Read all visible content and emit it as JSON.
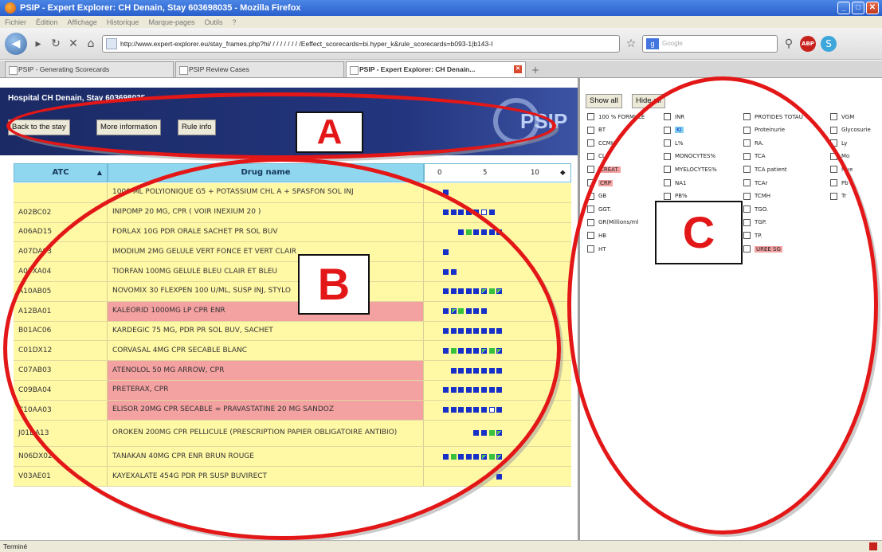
{
  "window": {
    "title": "PSIP - Expert Explorer: CH Denain, Stay 603698035 - Mozilla Firefox"
  },
  "menu": [
    "Fichier",
    "Édition",
    "Affichage",
    "Historique",
    "Marque-pages",
    "Outils",
    "?"
  ],
  "navbar": {
    "url": "http://www.expert-explorer.eu/stay_frames.php?hi/ / / / / / / / /Eeffect_scorecards=bi.hyper_k&rule_scorecards=b093-1|b143-I",
    "search_placeholder": "Google"
  },
  "tabs": [
    {
      "label": "PSIP - Generating Scorecards"
    },
    {
      "label": "PSIP Review Cases"
    },
    {
      "label": "PSIP - Expert Explorer: CH Denain..."
    }
  ],
  "header": {
    "hospital": "Hospital CH Denain, Stay 603698035",
    "buttons": [
      "Back to the stay",
      "More information",
      "Rule info"
    ],
    "logo": "PSIP"
  },
  "grid": {
    "headers": {
      "atc": "ATC",
      "drug": "Drug name",
      "scale": [
        "0",
        "5",
        "10"
      ]
    },
    "rows": [
      {
        "atc": "",
        "drug": "1000 ML POLYIONIQUE G5 + POTASSIUM CHL A + SPASFON SOL INJ",
        "red": false,
        "marks": [
          "b"
        ],
        "offset": 0
      },
      {
        "atc": "A02BC02",
        "drug": "INIPOMP 20 MG, CPR ( VOIR INEXIUM 20 )",
        "red": false,
        "marks": [
          "b",
          "b",
          "b",
          "b",
          "b",
          "h",
          "b"
        ],
        "offset": 0
      },
      {
        "atc": "A06AD15",
        "drug": "FORLAX 10G PDR ORALE SACHET PR SOL BUV",
        "red": false,
        "marks": [
          "b",
          "g",
          "b",
          "b",
          "b",
          "b"
        ],
        "offset": 2
      },
      {
        "atc": "A07DA03",
        "drug": "IMODIUM 2MG GELULE VERT FONCE ET VERT CLAIR",
        "red": false,
        "marks": [
          "b"
        ],
        "offset": 0
      },
      {
        "atc": "A07XA04",
        "drug": "TIORFAN 100MG GELULE BLEU CLAIR ET BLEU",
        "red": false,
        "marks": [
          "b",
          "b"
        ],
        "offset": 0
      },
      {
        "atc": "A10AB05",
        "drug": "NOVOMIX 30 FLEXPEN 100 U/ML, SUSP INJ, STYLO",
        "red": false,
        "marks": [
          "b",
          "b",
          "b",
          "b",
          "b",
          "m",
          "g",
          "m"
        ],
        "offset": 0
      },
      {
        "atc": "A12BA01",
        "drug": "KALEORID 1000MG LP CPR ENR",
        "red": true,
        "marks": [
          "b",
          "m",
          "g",
          "b",
          "b",
          "b"
        ],
        "offset": 0
      },
      {
        "atc": "B01AC06",
        "drug": "KARDEGIC 75 MG, PDR PR SOL BUV, SACHET",
        "red": false,
        "marks": [
          "b",
          "b",
          "b",
          "b",
          "b",
          "b",
          "b",
          "b"
        ],
        "offset": 0
      },
      {
        "atc": "C01DX12",
        "drug": "CORVASAL 4MG CPR SECABLE BLANC",
        "red": false,
        "marks": [
          "b",
          "g",
          "b",
          "b",
          "b",
          "m",
          "g",
          "m"
        ],
        "offset": 0
      },
      {
        "atc": "C07AB03",
        "drug": "ATENOLOL 50 MG ARROW, CPR",
        "red": true,
        "marks": [
          "b",
          "b",
          "b",
          "b",
          "b",
          "b",
          "b"
        ],
        "offset": 1
      },
      {
        "atc": "C09BA04",
        "drug": "PRETERAX, CPR",
        "red": true,
        "marks": [
          "b",
          "b",
          "b",
          "b",
          "b",
          "b",
          "b",
          "b"
        ],
        "offset": 0
      },
      {
        "atc": "C10AA03",
        "drug": "ELISOR 20MG CPR SECABLE = PRAVASTATINE 20 MG SANDOZ",
        "red": true,
        "marks": [
          "b",
          "b",
          "b",
          "b",
          "b",
          "b",
          "h",
          "b"
        ],
        "offset": 0
      },
      {
        "atc": "J01DA13",
        "drug": "OROKEN 200MG CPR PELLICULE (PRESCRIPTION PAPIER OBLIGATOIRE ANTIBIO)",
        "red": false,
        "marks": [
          "b",
          "b",
          "g",
          "m"
        ],
        "offset": 4
      },
      {
        "atc": "N06DX02",
        "drug": "TANAKAN 40MG CPR ENR BRUN ROUGE",
        "red": false,
        "marks": [
          "b",
          "g",
          "b",
          "b",
          "b",
          "m",
          "g",
          "m"
        ],
        "offset": 0
      },
      {
        "atc": "V03AE01",
        "drug": "KAYEXALATE 454G PDR PR SUSP BUVIRECT",
        "red": false,
        "marks": [
          "b"
        ],
        "offset": 7
      }
    ]
  },
  "filters": {
    "show_all": "Show all",
    "hide_all": "Hide all",
    "col1": [
      {
        "label": "100 % FORMULE",
        "hl": ""
      },
      {
        "label": "BT",
        "hl": ""
      },
      {
        "label": "CCMH",
        "hl": ""
      },
      {
        "label": "CL",
        "hl": ""
      },
      {
        "label": "CREAT.",
        "hl": "red"
      },
      {
        "label": "CRP",
        "hl": "red"
      },
      {
        "label": "GB",
        "hl": ""
      },
      {
        "label": "GGT.",
        "hl": ""
      },
      {
        "label": "GR(Millions/ml",
        "hl": ""
      },
      {
        "label": "HB",
        "hl": ""
      },
      {
        "label": "HT",
        "hl": ""
      }
    ],
    "col2": [
      {
        "label": "INR",
        "hl": ""
      },
      {
        "label": "KI",
        "hl": "blue"
      },
      {
        "label": "L%",
        "hl": ""
      },
      {
        "label": "MONOCYTES%",
        "hl": ""
      },
      {
        "label": "MYELOCYTES%",
        "hl": ""
      },
      {
        "label": "NA1",
        "hl": ""
      },
      {
        "label": "PB%",
        "hl": ""
      }
    ],
    "col3": [
      {
        "label": "PROTIDES TOTAU",
        "hl": ""
      },
      {
        "label": "Proteinurie",
        "hl": ""
      },
      {
        "label": "RA.",
        "hl": ""
      },
      {
        "label": "TCA",
        "hl": ""
      },
      {
        "label": "TCA patient",
        "hl": ""
      },
      {
        "label": "TCAr",
        "hl": ""
      },
      {
        "label": "TCMH",
        "hl": ""
      },
      {
        "label": "TGO.",
        "hl": ""
      },
      {
        "label": "TGP.",
        "hl": ""
      },
      {
        "label": "TP.",
        "hl": ""
      },
      {
        "label": "UREE SG",
        "hl": "red"
      }
    ],
    "col4": [
      {
        "label": "VGM",
        "hl": ""
      },
      {
        "label": "Glycosurie",
        "hl": ""
      },
      {
        "label": "Ly",
        "hl": ""
      },
      {
        "label": "Mo",
        "hl": ""
      },
      {
        "label": "Mye",
        "hl": ""
      },
      {
        "label": "Pb",
        "hl": ""
      },
      {
        "label": "Tr",
        "hl": ""
      }
    ]
  },
  "annotations": {
    "a": "A",
    "b": "B",
    "c": "C"
  },
  "status": "Terminé",
  "colors": {
    "marker_blue": "#1630c8",
    "marker_green": "#38c23c",
    "row_yellow": "#fff8a5",
    "row_red": "#f4a1a1",
    "annotation_red": "#e31717"
  }
}
